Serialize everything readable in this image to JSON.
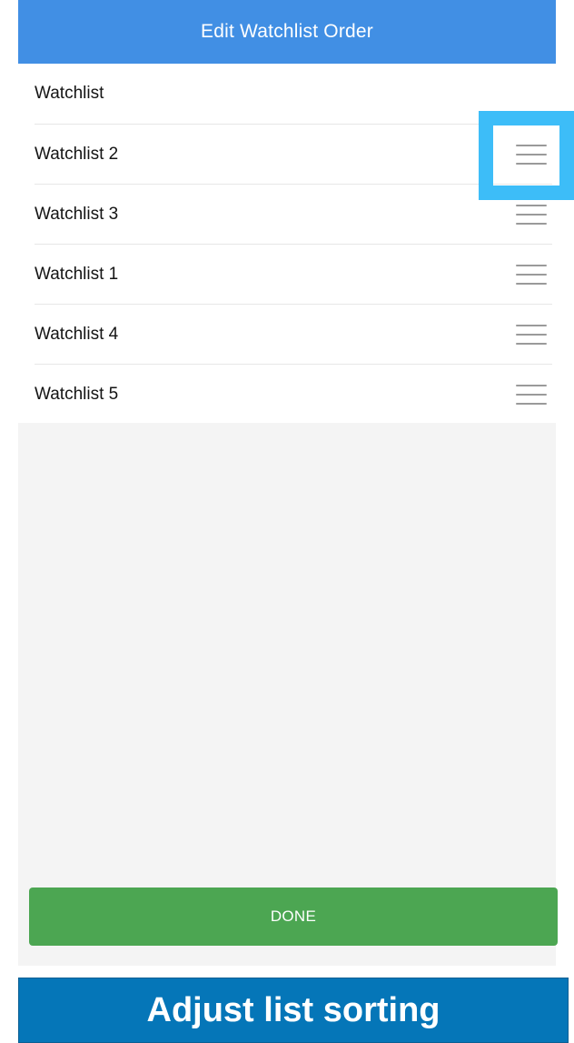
{
  "header": {
    "title": "Edit Watchlist Order",
    "background_color": "#418fe4"
  },
  "watchlists": [
    {
      "label": "Watchlist",
      "handle_icon": "drag-handle-icon",
      "has_handle": false
    },
    {
      "label": "Watchlist 2",
      "handle_icon": "drag-handle-icon",
      "has_handle": true,
      "highlighted": true
    },
    {
      "label": "Watchlist 3",
      "handle_icon": "drag-handle-icon",
      "has_handle": true
    },
    {
      "label": "Watchlist 1",
      "handle_icon": "drag-handle-icon",
      "has_handle": true
    },
    {
      "label": "Watchlist 4",
      "handle_icon": "drag-handle-icon",
      "has_handle": true
    },
    {
      "label": "Watchlist 5",
      "handle_icon": "drag-handle-icon",
      "has_handle": true
    }
  ],
  "footer": {
    "done_label": "DONE",
    "done_color": "#4ca652"
  },
  "caption": {
    "text": "Adjust list sorting",
    "background_color": "#0576b8"
  },
  "highlight_color": "#3dbdf8"
}
